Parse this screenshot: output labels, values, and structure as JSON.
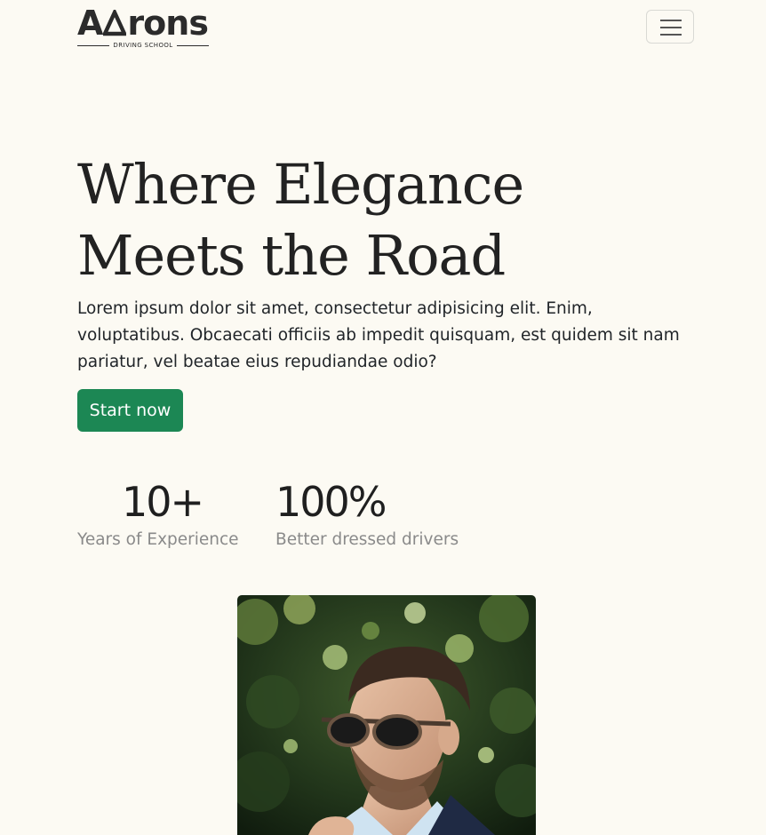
{
  "header": {
    "logo_word": "AArons",
    "logo_subtitle": "DRIVING SCHOOL",
    "menu_icon": "hamburger-icon"
  },
  "hero": {
    "title_line1": "Where Elegance",
    "title_line2": "Meets the Road",
    "description": "Lorem ipsum dolor sit amet, consectetur adipisicing elit. Enim, voluptatibus. Obcaecati officiis ab impedit quisquam, est quidem sit nam pariatur, vel beatae eius repudiandae odio?",
    "cta_label": "Start now"
  },
  "stats": [
    {
      "value": "10+",
      "label": "Years of Experience"
    },
    {
      "value": "100%",
      "label": "Better dressed drivers"
    }
  ],
  "image": {
    "subject": "man in sunglasses adjusting collar in front of green foliage"
  },
  "colors": {
    "background": "#fcfaf3",
    "accent": "#1c8754",
    "text": "#212529",
    "muted": "#8a8a8a"
  }
}
